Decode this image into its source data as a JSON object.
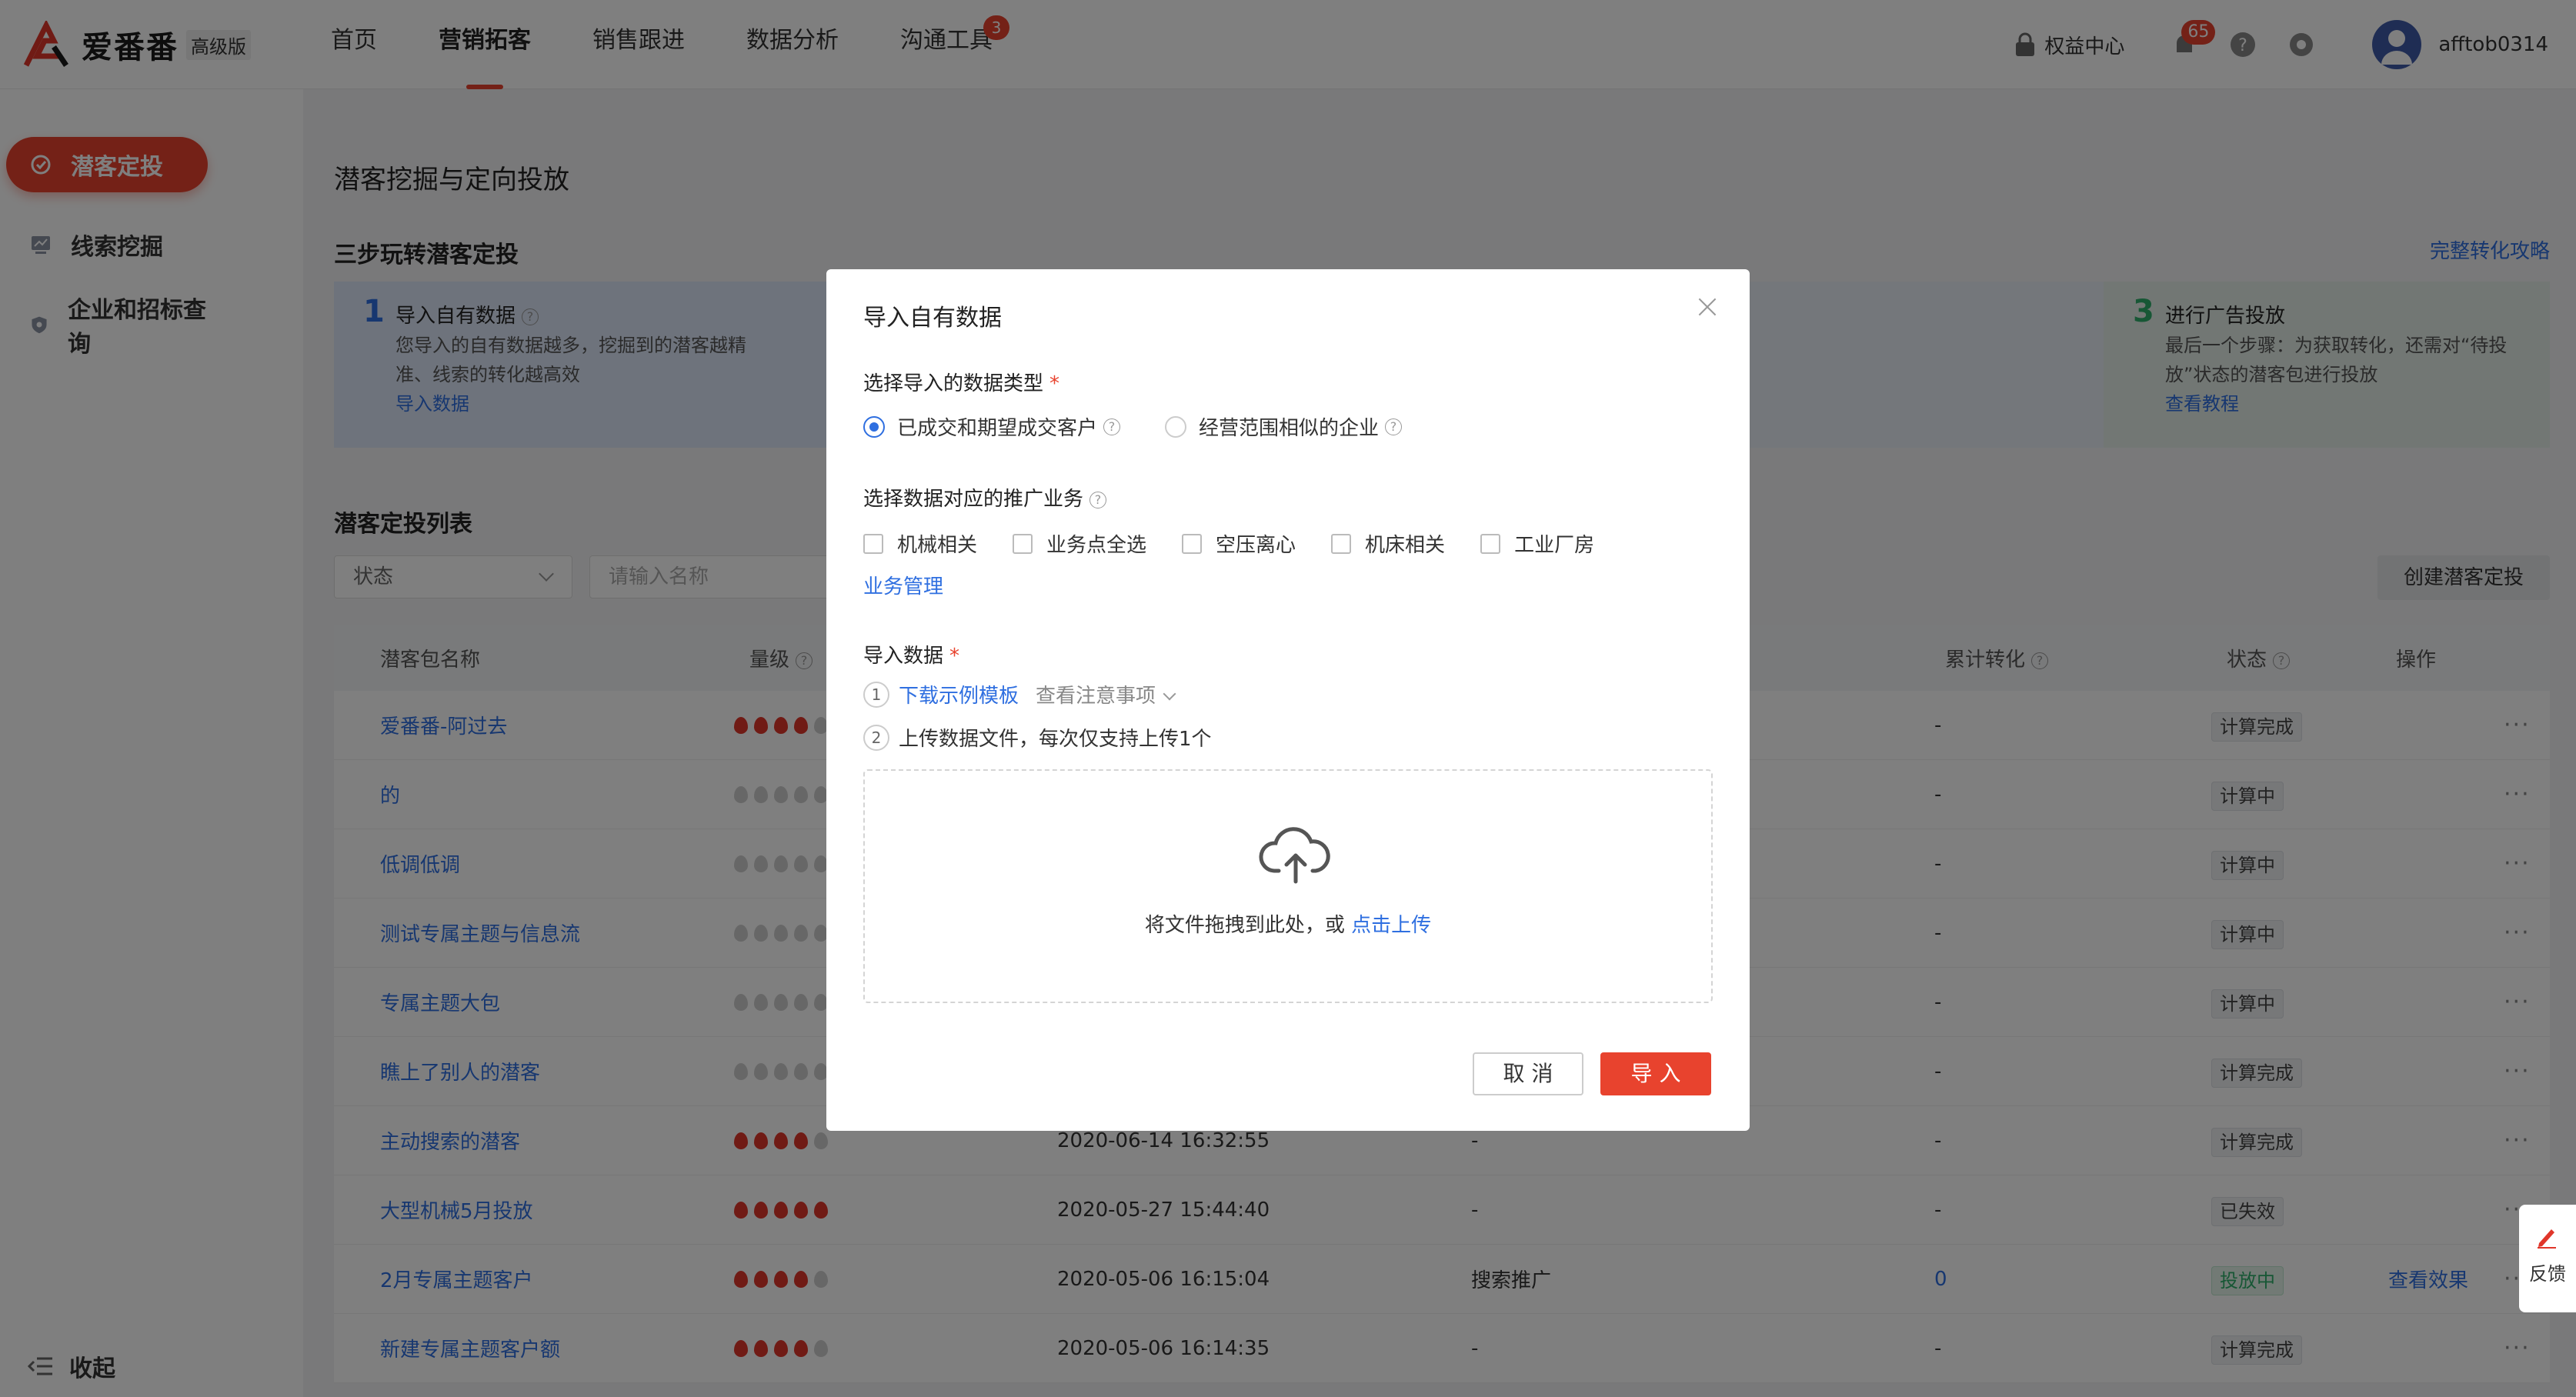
{
  "brand": {
    "name": "爱番番",
    "edition": "高级版"
  },
  "nav": [
    {
      "label": "首页",
      "active": false,
      "badge": ""
    },
    {
      "label": "营销拓客",
      "active": true,
      "badge": ""
    },
    {
      "label": "销售跟进",
      "active": false,
      "badge": ""
    },
    {
      "label": "数据分析",
      "active": false,
      "badge": ""
    },
    {
      "label": "沟通工具",
      "active": false,
      "badge": "3"
    }
  ],
  "top_right": {
    "rights": "权益中心",
    "notifications": "65",
    "username": "afftob0314"
  },
  "sidebar": {
    "items": [
      {
        "label": "潜客定投",
        "active": true
      },
      {
        "label": "线索挖掘",
        "active": false
      },
      {
        "label": "企业和招标查询",
        "active": false
      }
    ],
    "collapse": "收起"
  },
  "main": {
    "page_title": "潜客挖掘与定向投放",
    "section_title": "三步玩转潜客定投",
    "full_guide": "完整转化攻略",
    "step1": {
      "num": "1",
      "title": "导入自有数据",
      "desc1": "您导入的自有数据越多，挖掘到的潜客越精",
      "desc2": "准、线索的转化越高效",
      "link": "导入数据"
    },
    "step3": {
      "num": "3",
      "title": "进行广告投放",
      "desc1": "最后一个步骤：为获取转化，还需对“待投",
      "desc2": "放”状态的潜客包进行投放",
      "link": "查看教程"
    },
    "list_title": "潜客定投列表",
    "filter_status": "状态",
    "search_placeholder": "请输入名称",
    "create_button": "创建潜客定投",
    "columns": {
      "name": "潜客包名称",
      "level": "量级",
      "cum": "累计转化",
      "status": "状态",
      "op": "操作"
    },
    "rows": [
      {
        "name": "爱番番-阿过去",
        "level": 4,
        "date": "",
        "channel": "",
        "cum": "-",
        "status": "计算完成",
        "op": ""
      },
      {
        "name": "的",
        "level": 0,
        "date": "",
        "channel": "",
        "cum": "-",
        "status": "计算中",
        "op": ""
      },
      {
        "name": "低调低调",
        "level": 0,
        "date": "",
        "channel": "",
        "cum": "-",
        "status": "计算中",
        "op": ""
      },
      {
        "name": "测试专属主题与信息流",
        "level": 0,
        "date": "",
        "channel": "",
        "cum": "-",
        "status": "计算中",
        "op": ""
      },
      {
        "name": "专属主题大包",
        "level": 0,
        "date": "",
        "channel": "",
        "cum": "-",
        "status": "计算中",
        "op": ""
      },
      {
        "name": "瞧上了别人的潜客",
        "level": 0,
        "date": "",
        "channel": "",
        "cum": "-",
        "status": "计算完成",
        "op": ""
      },
      {
        "name": "主动搜索的潜客",
        "level": 4,
        "date": "2020-06-14 16:32:55",
        "channel": "-",
        "cum": "-",
        "status": "计算完成",
        "op": ""
      },
      {
        "name": "大型机械5月投放",
        "level": 5,
        "date": "2020-05-27 15:44:40",
        "channel": "-",
        "cum": "-",
        "status": "已失效",
        "op": ""
      },
      {
        "name": "2月专属主题客户",
        "level": 4,
        "date": "2020-05-06 16:15:04",
        "channel": "搜索推广",
        "cum": "0",
        "status": "投放中",
        "op": "查看效果"
      },
      {
        "name": "新建专属主题客户额",
        "level": 4,
        "date": "2020-05-06 16:14:35",
        "channel": "-",
        "cum": "-",
        "status": "计算完成",
        "op": ""
      }
    ]
  },
  "feedback": "反馈",
  "modal": {
    "title": "导入自有数据",
    "type_label": "选择导入的数据类型",
    "type_options": [
      "已成交和期望成交客户",
      "经营范围相似的企业"
    ],
    "biz_label": "选择数据对应的推广业务",
    "biz_options": [
      "机械相关",
      "业务点全选",
      "空压离心",
      "机床相关",
      "工业厂房"
    ],
    "biz_manage": "业务管理",
    "import_label": "导入数据",
    "step1_num": "1",
    "step1_link": "下载示例模板",
    "step1_hint": "查看注意事项",
    "step2_num": "2",
    "step2_text": "上传数据文件，每次仅支持上传1个",
    "drop_text": "将文件拖拽到此处，或",
    "drop_link": "点击上传",
    "cancel": "取 消",
    "ok": "导 入"
  },
  "colors": {
    "accent": "#e8432e",
    "link": "#2f6fe0",
    "success": "#2fae6b"
  }
}
